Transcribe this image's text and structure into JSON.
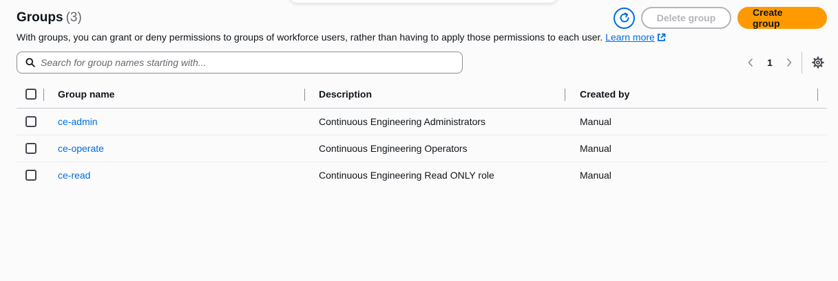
{
  "header": {
    "title": "Groups",
    "count": "(3)",
    "refresh_icon": "refresh-icon",
    "delete_label": "Delete group",
    "create_label": "Create group"
  },
  "description": {
    "text": "With groups, you can grant or deny permissions to groups of workforce users, rather than having to apply those permissions to each user.",
    "link_label": "Learn more"
  },
  "search": {
    "placeholder": "Search for group names starting with..."
  },
  "pagination": {
    "current_page": "1"
  },
  "table": {
    "columns": [
      "Group name",
      "Description",
      "Created by"
    ],
    "rows": [
      {
        "name": "ce-admin",
        "description": "Continuous Engineering Administrators",
        "created_by": "Manual"
      },
      {
        "name": "ce-operate",
        "description": "Continuous Engineering Operators",
        "created_by": "Manual"
      },
      {
        "name": "ce-read",
        "description": "Continuous Engineering Read ONLY role",
        "created_by": "Manual"
      }
    ]
  },
  "colors": {
    "primary": "#ff9900",
    "link": "#006ce0",
    "disabled": "#b4b4bb"
  }
}
